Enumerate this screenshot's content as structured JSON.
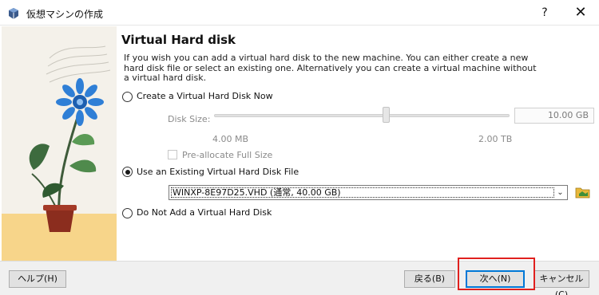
{
  "window": {
    "title": "仮想マシンの作成",
    "help_label": "?",
    "close_label": "✕"
  },
  "page": {
    "heading": "Virtual Hard disk",
    "description": "If you wish you can add a virtual hard disk to the new machine. You can either create a new hard disk file or select an existing one. Alternatively you can create a virtual machine without a virtual hard disk."
  },
  "options": {
    "create_new": {
      "label": "Create a Virtual Hard Disk Now",
      "selected": false
    },
    "use_existing": {
      "label": "Use an Existing Virtual Hard Disk File",
      "selected": true
    },
    "do_not_add": {
      "label": "Do Not Add a Virtual Hard Disk",
      "selected": false
    }
  },
  "disk_size": {
    "label": "Disk Size:",
    "value": "10.00 GB",
    "min_label": "4.00 MB",
    "max_label": "2.00 TB"
  },
  "preallocate": {
    "label": "Pre-allocate Full Size",
    "checked": false
  },
  "existing_disk": {
    "selected": "WINXP-8E97D25.VHD (通常, 40.00 GB)"
  },
  "buttons": {
    "help": "ヘルプ(H)",
    "back": "戻る(B)",
    "next": "次へ(N)",
    "cancel": "キャンセル(C)"
  },
  "colors": {
    "accent_border": "#0078d7",
    "highlight": "#e0201e",
    "illustration_bg": "#f4f1ea",
    "illustration_floor": "#f7d58a",
    "flower": "#2f7fd6"
  },
  "icons": [
    "virtualbox-app-icon",
    "folder-icon",
    "chevron-down-icon"
  ]
}
